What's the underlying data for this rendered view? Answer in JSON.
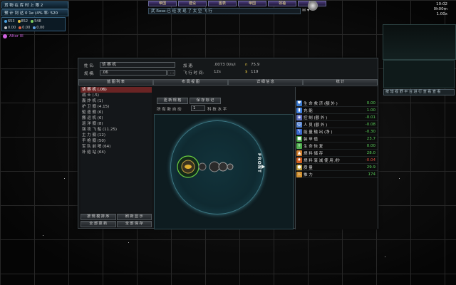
{
  "hud": {
    "cargo_line": "货 物 在 库 时 上 限 2",
    "arrival_line": "预 计 到 达 0 1e (4% 率: 520",
    "resources": [
      {
        "label": "653",
        "value": "653",
        "color": "#4aa0e0"
      },
      {
        "label": "852",
        "value": "852",
        "color": "#e0c040"
      },
      {
        "label": "548",
        "value": "548",
        "color": "#80d060"
      },
      {
        "label": "0.00",
        "value": "0.00",
        "color": "#c0c0c0"
      },
      {
        "label": "0.00",
        "value": "0.00",
        "color": "#e06040"
      },
      {
        "label": "0.00",
        "value": "0.00",
        "color": "#60a0e0"
      }
    ],
    "player_name": "Altor III"
  },
  "top_menu": [
    "帝国",
    "建设",
    "图表",
    "帝国",
    "领袖",
    "外交"
  ],
  "ticker_text": "武 Rose-已 经 发 现 了 太 空 飞 行",
  "clock": {
    "time": "10:02",
    "elapsed": "0h00m",
    "speed": "1.00x"
  },
  "minimap_button": "按 辖 视 野 平 台 进 行 查 看 查 看",
  "dialog": {
    "name_label": "姓 名:",
    "name_value": "侦 察 机",
    "scale_label": "规 模:",
    "scale_value": ".06",
    "speed_label": "加 速:",
    "speed_value": ".0073 0l/s/i",
    "time_label": "飞 行 时 间:",
    "time_value": "12s",
    "mass_label": "n",
    "mass_value": "75.9",
    "cost_label": "$",
    "cost_value": "119",
    "tabs": [
      "蓝 图 列 表",
      "布 局 视 图",
      "详 细 信 息",
      "统 计"
    ],
    "list": [
      "侦 察 机 (.06)",
      "战 士 (.5)",
      "轰 炸 机 (1)",
      "护 卫 舰 (4.15)",
      "驱 逐 舰 (6)",
      "搬 运 机 (6)",
      "巡 洋 舰 (8)",
      "强 攻 飞 船 (11.25)",
      "主 力 舰 (12)",
      "手 枪 舰 (50)",
      "军 队 前 哨 (64)",
      "补 给 站 (64)"
    ],
    "list_buttons": [
      "按 规 模 排 序",
      "刷 新 显 示",
      "全 部 更 新",
      "全 部 保 存"
    ],
    "ctrl_buttons": [
      "更 新 规 格",
      "保 存 标 记"
    ],
    "tech_label": "所 有 新 自 动",
    "tech_value": "1",
    "tech_suffix": "科 技 水 平",
    "front_label": "FRONT",
    "stats": [
      {
        "name": "生 命 救 济 (额 外 )",
        "value": "0.00",
        "color": "#3a7ad0",
        "icon": "life-support-icon"
      },
      {
        "name": "充 能",
        "value": "1.00",
        "color": "#4080e0",
        "icon": "charge-icon"
      },
      {
        "name": "控 制 (额 外 )",
        "value": "-0.01",
        "color": "#6070c0",
        "icon": "control-icon"
      },
      {
        "name": "人 员 (额 外 )",
        "value": "-0.08",
        "color": "#5080d0",
        "icon": "crew-icon"
      },
      {
        "name": "能 量 输 出 (净 )",
        "value": "-0.30",
        "color": "#3a6ad0",
        "icon": "power-icon"
      },
      {
        "name": "装 甲 值",
        "value": "23.7",
        "color": "#40a040",
        "icon": "armor-icon"
      },
      {
        "name": "生 命 恢 复",
        "value": "0.00",
        "color": "#50b050",
        "icon": "repair-icon"
      },
      {
        "name": "燃 料 储 存",
        "value": "28.0",
        "color": "#d08030",
        "icon": "fuel-storage-icon"
      },
      {
        "name": "燃 料 衰 减 使 用 /秒",
        "value": "-0.04",
        "color": "#d06020",
        "icon": "fuel-use-icon"
      },
      {
        "name": "质 量",
        "value": "29.9",
        "color": "#c0a040",
        "icon": "mass-icon"
      },
      {
        "name": "推 力",
        "value": "174",
        "color": "#d09030",
        "icon": "thrust-icon"
      }
    ]
  }
}
